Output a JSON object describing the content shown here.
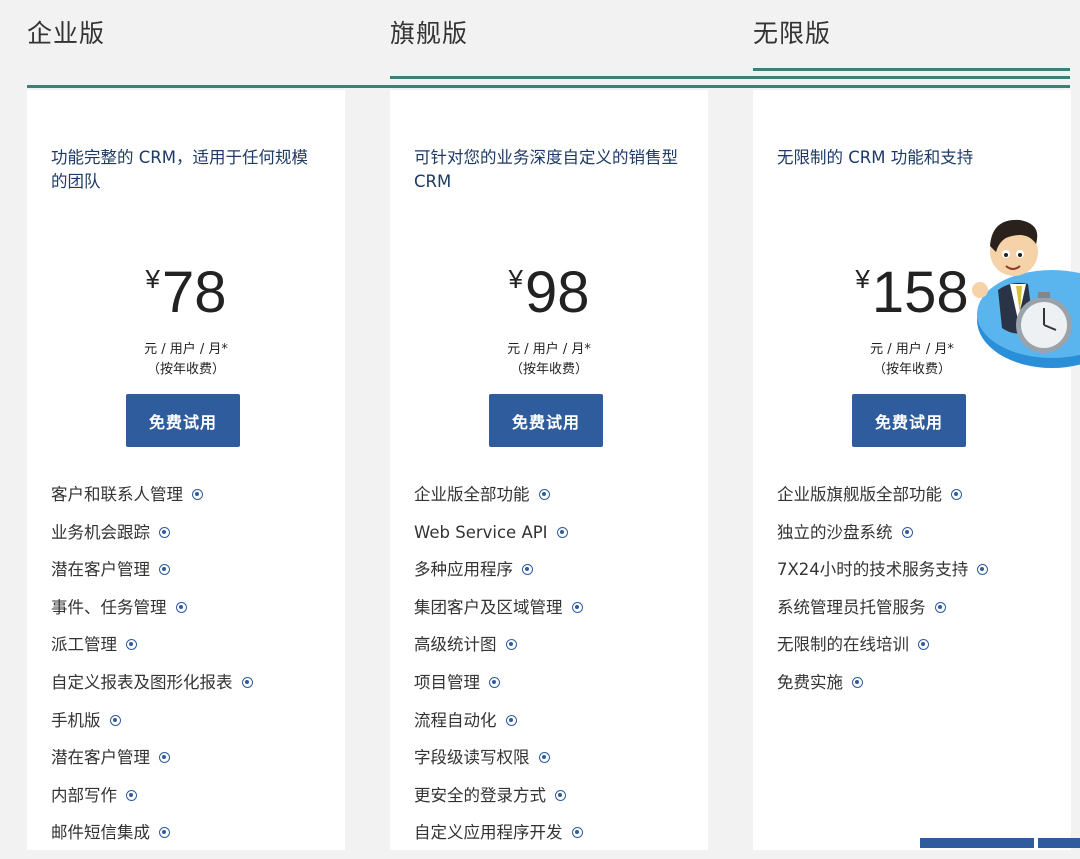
{
  "plans": [
    {
      "tab": "企业版",
      "description": "功能完整的 CRM，适用于任何规模的团队",
      "currency": "¥",
      "price": "78",
      "unit_line1": "元 / 用户 / 月*",
      "unit_line2": "（按年收费）",
      "button": "免费试用",
      "features": [
        "客户和联系人管理",
        "业务机会跟踪",
        "潜在客户管理",
        "事件、任务管理",
        "派工管理",
        "自定义报表及图形化报表",
        "手机版",
        "潜在客户管理",
        "内部写作",
        "邮件短信集成"
      ]
    },
    {
      "tab": "旗舰版",
      "description": "可针对您的业务深度自定义的销售型 CRM",
      "currency": "¥",
      "price": "98",
      "unit_line1": "元 / 用户 / 月*",
      "unit_line2": "（按年收费）",
      "button": "免费试用",
      "features": [
        "企业版全部功能",
        "Web Service API",
        "多种应用程序",
        "集团客户及区域管理",
        "高级统计图",
        "项目管理",
        "流程自动化",
        "字段级读写权限",
        "更安全的登录方式",
        "自定义应用程序开发"
      ]
    },
    {
      "tab": "无限版",
      "description": "无限制的 CRM 功能和支持",
      "currency": "¥",
      "price": "158",
      "unit_line1": "元 / 用户 / 月*",
      "unit_line2": "（按年收费）",
      "button": "免费试用",
      "features": [
        "企业版旗舰版全部功能",
        "独立的沙盘系统",
        "7X24小时的技术服务支持",
        "系统管理员托管服务",
        "无限制的在线培训",
        "免费实施"
      ]
    }
  ],
  "colors": {
    "accent": "#2f5c9c",
    "tab_line": "#3f7f78",
    "description": "#1e3a66"
  },
  "icons": {
    "feature": "info-icon",
    "mascot": "businessman-clock-illustration"
  }
}
